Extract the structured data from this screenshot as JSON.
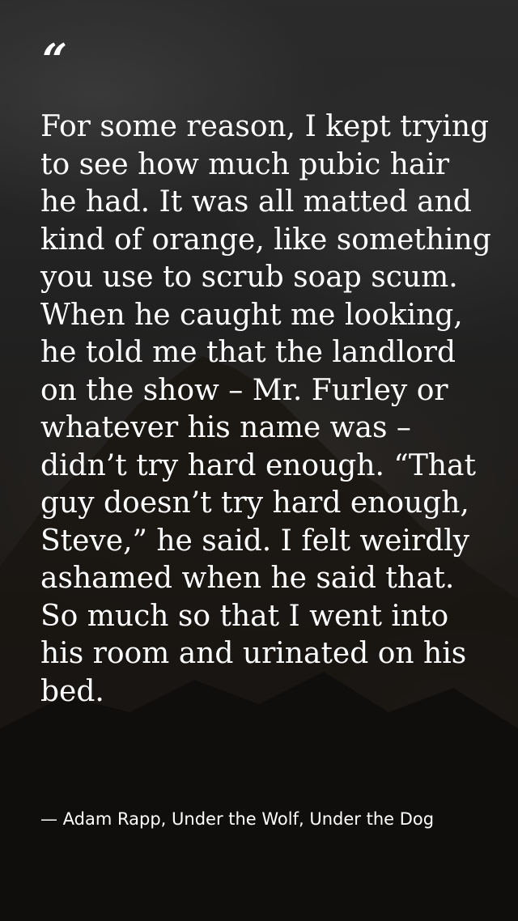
{
  "quote": {
    "open_mark": "“",
    "text": "For some reason, I kept trying to see how much pubic hair he had. It was all matted and kind of orange, like something you use to scrub soap scum. When he caught me looking, he told me that the landlord on the show – Mr. Furley or whatever his name was – didn’t try hard enough. “That guy doesn’t try hard enough, Steve,” he said. I felt weirdly ashamed when he said that. So much so that I went into his room and urinated on his bed.",
    "attribution": "— Adam Rapp, Under the Wolf, Under the Dog"
  },
  "colors": {
    "text": "#ffffff",
    "background_dark": "#1e1b19",
    "background_mid": "#2c2c2c"
  }
}
